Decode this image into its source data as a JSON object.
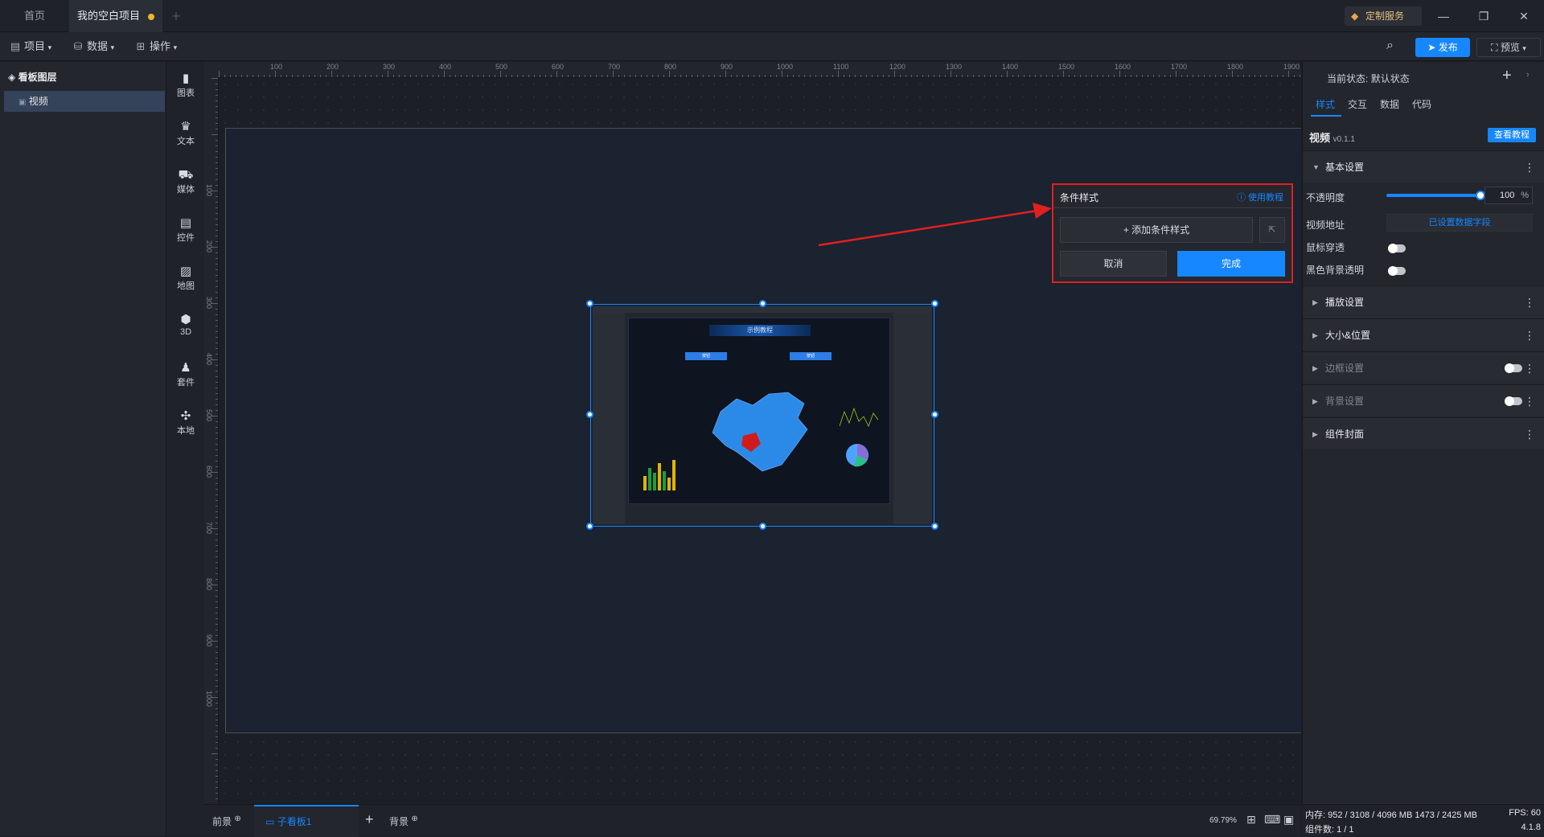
{
  "tabs": [
    {
      "label": "首页"
    },
    {
      "label": "我的空白项目"
    }
  ],
  "custom_service": "定制服务",
  "toolbar": {
    "project": "项目",
    "data": "数据",
    "operate": "操作",
    "publish": "发布",
    "preview": "预览"
  },
  "layers": {
    "title": "看板图层",
    "items": [
      {
        "label": "视频"
      }
    ]
  },
  "palette": [
    {
      "label": "图表",
      "icon": "bar-chart-icon"
    },
    {
      "label": "文本",
      "icon": "crown-text-icon"
    },
    {
      "label": "媒体",
      "icon": "media-icon"
    },
    {
      "label": "控件",
      "icon": "widget-icon"
    },
    {
      "label": "地图",
      "icon": "map-icon"
    },
    {
      "label": "3D",
      "icon": "cube-icon"
    },
    {
      "label": "套件",
      "icon": "shirt-icon"
    },
    {
      "label": "本地",
      "icon": "puzzle-icon"
    }
  ],
  "ruler": {
    "top": [
      "100",
      "200",
      "300",
      "400",
      "500",
      "600",
      "700",
      "800",
      "900",
      "1000",
      "1100",
      "1200",
      "1300",
      "1400",
      "1500",
      "1600",
      "1700",
      "1800",
      "1900"
    ],
    "left": [
      "100",
      "200",
      "300",
      "400",
      "500",
      "600",
      "700",
      "800",
      "900",
      "1000"
    ]
  },
  "preview_card": {
    "title": "示例教程",
    "btn1": "按钮",
    "btn2": "按钮"
  },
  "popup": {
    "title": "条件样式",
    "help": "使用教程",
    "add": "添加条件样式",
    "cancel": "取消",
    "done": "完成"
  },
  "rpanel": {
    "state_label": "当前状态:",
    "state_value": "默认状态",
    "tabs": [
      "样式",
      "交互",
      "数据",
      "代码"
    ],
    "component": "视频",
    "version": "v0.1.1",
    "tutorial": "查看教程",
    "basic": "基本设置",
    "opacity_label": "不透明度",
    "opacity_value": "100",
    "opacity_unit": "%",
    "opacity_level": 1.0,
    "video_url_label": "视频地址",
    "video_url_value": "已设置数据字段",
    "mouse_through": "鼠标穿透",
    "black_bg": "黑色背景透明",
    "sections": [
      "播放设置",
      "大小&位置",
      "边框设置",
      "背景设置",
      "组件封面"
    ]
  },
  "bottom": {
    "foreground": "前景",
    "sub_board": "子看板1",
    "background": "背景",
    "zoom": "69.79%"
  },
  "status": {
    "memory": "内存: 952 / 3108 / 4096 MB 1473 / 2425 MB",
    "fps": "FPS: 60",
    "components": "组件数: 1 / 1",
    "version": "4.1.8"
  },
  "colors": {
    "accent": "#1687ff",
    "highlight": "#e02020",
    "pending_dot": "#f0b429"
  }
}
